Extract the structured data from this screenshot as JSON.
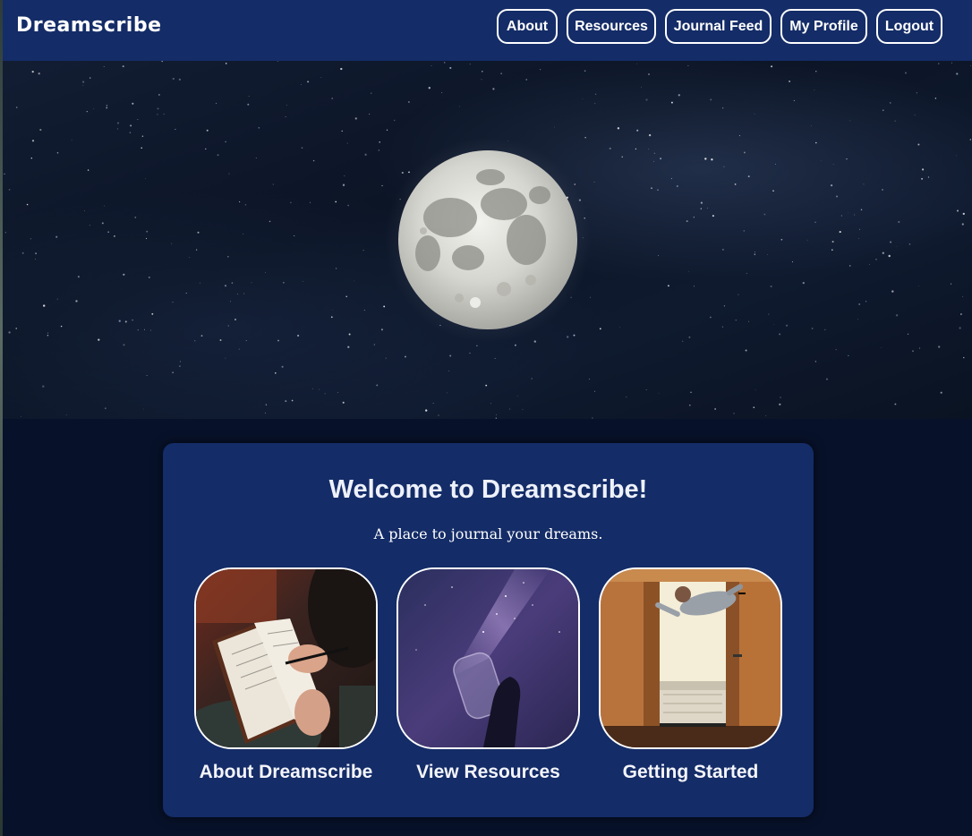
{
  "navbar": {
    "brand": "Dreamscribe",
    "links": [
      {
        "label": "About"
      },
      {
        "label": "Resources"
      },
      {
        "label": "Journal Feed"
      },
      {
        "label": "My Profile"
      },
      {
        "label": "Logout"
      }
    ]
  },
  "hero": {
    "image": "moon-night-sky"
  },
  "welcome": {
    "title": "Welcome to Dreamscribe!",
    "subtitle": "A place to journal your dreams.",
    "tiles": [
      {
        "image": "person-writing-journal",
        "label": "About Dreamscribe"
      },
      {
        "image": "jar-of-stars",
        "label": "View Resources"
      },
      {
        "image": "man-floating-over-bed",
        "label": "Getting Started"
      }
    ]
  },
  "colors": {
    "navbar": "#142c67",
    "page_background": "#071129",
    "card": "#142c67",
    "text": "#ffffff"
  }
}
